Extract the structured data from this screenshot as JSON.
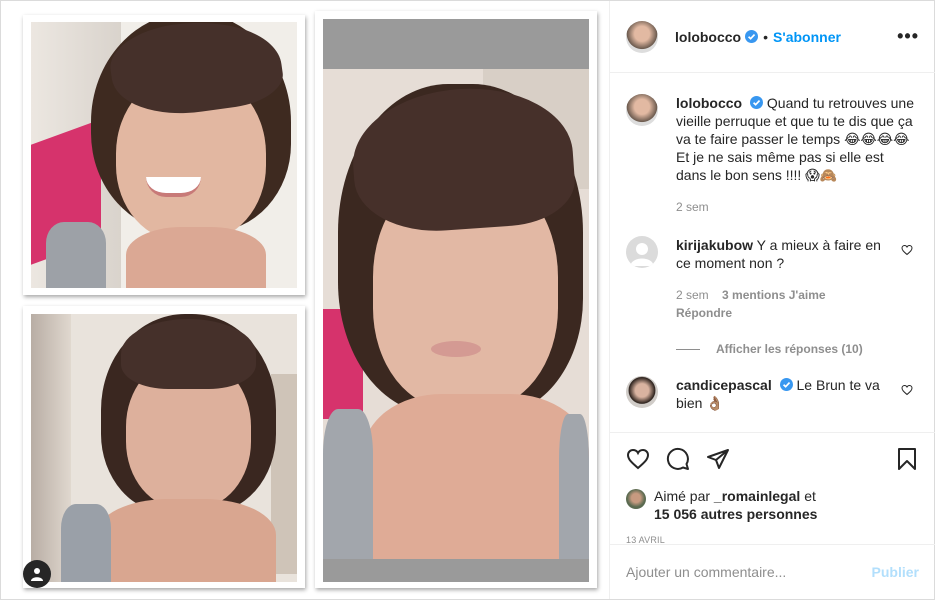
{
  "post": {
    "author": {
      "username": "lolobocco",
      "verified": true,
      "follow_label": "S'abonner",
      "separator": "•",
      "more_label": "•••"
    },
    "caption": {
      "username": "lolobocco",
      "text": "Quand tu retrouves une vieille perruque et que tu te dis que ça va te faire passer le temps 😂😂😂😂 Et je ne sais même pas si elle est dans le bon sens !!!! 😱🙈",
      "time": "2 sem"
    },
    "comments": [
      {
        "username": "kirijakubow",
        "text": "Y a mieux à faire en ce moment non ?",
        "time": "2 sem",
        "likes": "3 mentions J'aime",
        "reply_label": "Répondre",
        "view_replies": "Afficher les réponses (10)"
      },
      {
        "username": "candicepascal",
        "verified": true,
        "text": "Le Brun te va bien 👌🏽"
      }
    ],
    "liked_by": {
      "prefix": "Aimé par",
      "user": "_romainlegal",
      "connector": "et",
      "others": "15 056 autres personnes"
    },
    "date": "13 AVRIL",
    "add_comment": {
      "placeholder": "Ajouter un commentaire...",
      "publish_label": "Publier"
    }
  },
  "colors": {
    "accent": "#0095f6",
    "publish_disabled": "#b2dffc",
    "muted": "#8e8e8e",
    "text": "#262626",
    "border": "#dbdbdb"
  },
  "icons": [
    "user-tag-icon",
    "verified-badge-icon",
    "more-options-icon",
    "heart-icon",
    "comment-icon",
    "share-icon",
    "bookmark-icon"
  ]
}
